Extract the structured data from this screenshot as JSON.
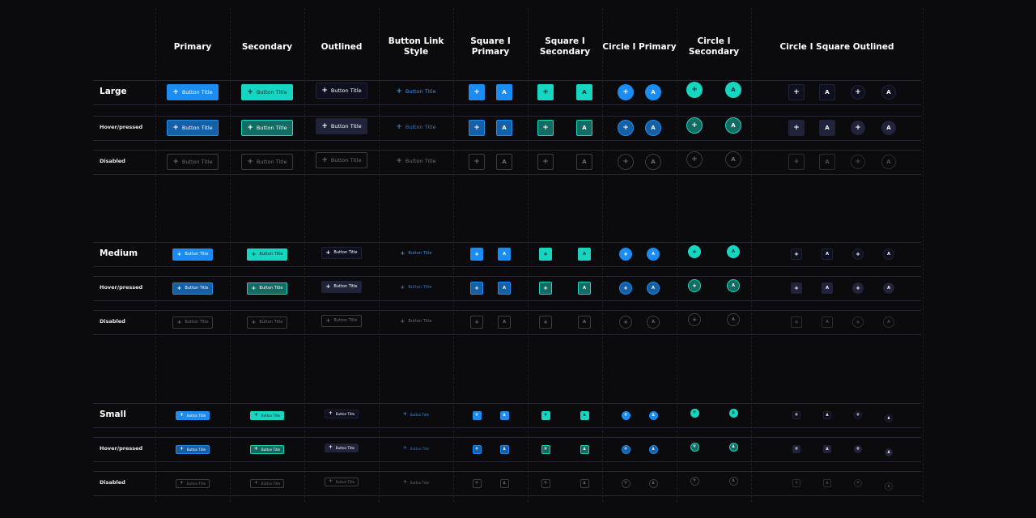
{
  "columns": [
    {
      "key": "primary",
      "label": "Primary"
    },
    {
      "key": "secondary",
      "label": "Secondary"
    },
    {
      "key": "outlined",
      "label": "Outlined"
    },
    {
      "key": "link",
      "label": "Button Link Style"
    },
    {
      "key": "sq_primary",
      "label": "Square I Primary"
    },
    {
      "key": "sq_secondary",
      "label": "Square I\nSecondary"
    },
    {
      "key": "ci_primary",
      "label": "Circle I Primary"
    },
    {
      "key": "ci_secondary",
      "label": "Circle I\nSecondary"
    },
    {
      "key": "ci_sq_outlined",
      "label": "Circle I Square Outlined"
    }
  ],
  "sizes": [
    {
      "key": "large",
      "label": "Large"
    },
    {
      "key": "medium",
      "label": "Medium"
    },
    {
      "key": "small",
      "label": "Small"
    }
  ],
  "states": [
    {
      "key": "default"
    },
    {
      "key": "hover",
      "label": "Hover/pressed"
    },
    {
      "key": "disabled",
      "label": "Disabled"
    }
  ],
  "button": {
    "title": "Button Title",
    "plus_glyph": "+",
    "letter_glyph": "A"
  },
  "colors": {
    "background": "#0b0b0d",
    "primary": "#1a8cf2",
    "primary_pressed": "#155fa5",
    "secondary": "#17d6c1",
    "secondary_pressed": "#136b62",
    "outlined_bg": "#0e1020",
    "outlined_pressed_bg": "#20233a",
    "link_text": "#3f8ee8",
    "link_text_pressed": "#3a75c0",
    "disabled_border": "#3b3b42",
    "disabled_text": "#6c6c74",
    "row_border": "#26253a"
  }
}
